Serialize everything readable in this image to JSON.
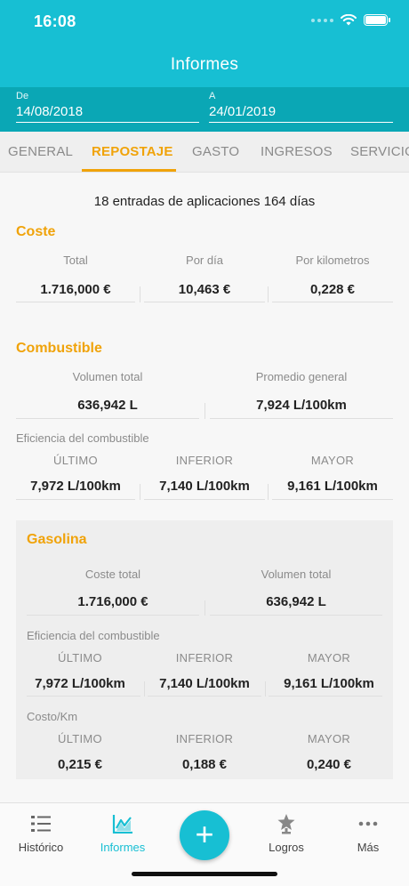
{
  "status": {
    "time": "16:08"
  },
  "header": {
    "title": "Informes"
  },
  "range": {
    "from_label": "De",
    "from_value": "14/08/2018",
    "to_label": "A",
    "to_value": "24/01/2019"
  },
  "tabs": [
    "GENERAL",
    "REPOSTAJE",
    "GASTO",
    "INGRESOS",
    "SERVICIO"
  ],
  "active_tab": "REPOSTAJE",
  "summary": "18 entradas de aplicaciones 164 días",
  "cost": {
    "title": "Coste",
    "items": [
      {
        "label": "Total",
        "value": "1.716,000 €"
      },
      {
        "label": "Por día",
        "value": "10,463 €"
      },
      {
        "label": "Por kilometros",
        "value": "0,228 €"
      }
    ]
  },
  "fuel": {
    "title": "Combustible",
    "items": [
      {
        "label": "Volumen total",
        "value": "636,942 L"
      },
      {
        "label": "Promedio general",
        "value": "7,924 L/100km"
      }
    ],
    "efficiency_label": "Eficiencia del combustible",
    "efficiency": [
      {
        "label": "ÚLTIMO",
        "value": "7,972 L/100km"
      },
      {
        "label": "INFERIOR",
        "value": "7,140 L/100km"
      },
      {
        "label": "MAYOR",
        "value": "9,161 L/100km"
      }
    ]
  },
  "gasoline": {
    "title": "Gasolina",
    "items": [
      {
        "label": "Coste total",
        "value": "1.716,000 €"
      },
      {
        "label": "Volumen total",
        "value": "636,942 L"
      }
    ],
    "efficiency_label": "Eficiencia del combustible",
    "efficiency": [
      {
        "label": "ÚLTIMO",
        "value": "7,972 L/100km"
      },
      {
        "label": "INFERIOR",
        "value": "7,140 L/100km"
      },
      {
        "label": "MAYOR",
        "value": "9,161 L/100km"
      }
    ],
    "cost_km_label": "Costo/Km",
    "cost_km": [
      {
        "label": "ÚLTIMO",
        "value": "0,215 €"
      },
      {
        "label": "INFERIOR",
        "value": "0,188 €"
      },
      {
        "label": "MAYOR",
        "value": "0,240 €"
      }
    ]
  },
  "nav": [
    {
      "label": "Histórico",
      "icon": "list-icon"
    },
    {
      "label": "Informes",
      "icon": "chart-icon"
    },
    {
      "label": "",
      "icon": "plus-icon"
    },
    {
      "label": "Logros",
      "icon": "trophy-icon"
    },
    {
      "label": "Más",
      "icon": "more-dots-icon"
    }
  ],
  "colors": {
    "primary": "#17bfd3",
    "accent": "#f0a30a",
    "low": "#7dba3f",
    "high": "#e0453a"
  }
}
